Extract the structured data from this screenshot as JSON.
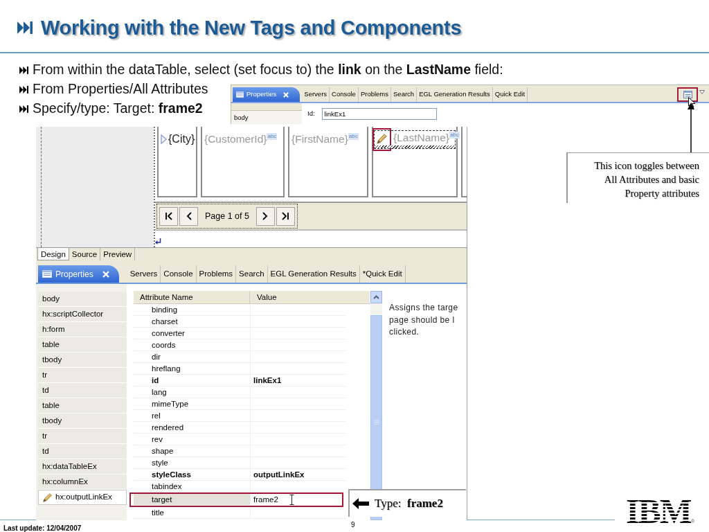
{
  "title": "Working with the New Tags and Components",
  "bullets": [
    "From within the dataTable, select (set focus to) the **link** on the **LastName** field:",
    "From Properties/All Attributes",
    "Specify/type: Target: **frame2**"
  ],
  "top_view": {
    "tabs": [
      {
        "label": "Properties",
        "selected": true
      },
      {
        "label": "Servers",
        "selected": false
      },
      {
        "label": "Console",
        "selected": false
      },
      {
        "label": "Problems",
        "selected": false
      },
      {
        "label": "Search",
        "selected": false
      },
      {
        "label": "EGL Generation Results",
        "selected": false
      },
      {
        "label": "Quick Edit",
        "selected": false
      }
    ],
    "tree_items": [
      {
        "label": "body"
      }
    ],
    "id_field": {
      "label": "Id:",
      "value": "linkEx1"
    }
  },
  "toggle_callout": {
    "lines": [
      "This icon toggles between",
      "All Attributes and basic",
      "Property attributes"
    ]
  },
  "design_view": {
    "columns": [
      {
        "kind": "text",
        "label": "{City}",
        "selected": false
      },
      {
        "kind": "output",
        "label": "{CustomerId}",
        "badge": "abc",
        "selected": false
      },
      {
        "kind": "output",
        "label": "{FirstName}",
        "badge": "abc",
        "selected": false
      },
      {
        "kind": "link",
        "label": "{LastName}",
        "badge": "abc",
        "selected": true
      }
    ],
    "pager": {
      "label": "Page 1 of 5"
    },
    "tabs": [
      {
        "label": "Design",
        "selected": true
      },
      {
        "label": "Source",
        "selected": false
      },
      {
        "label": "Preview",
        "selected": false
      }
    ]
  },
  "properties_view": {
    "tabs": [
      {
        "label": "Properties",
        "selected": true
      },
      {
        "label": "Servers",
        "selected": false
      },
      {
        "label": "Console",
        "selected": false
      },
      {
        "label": "Problems",
        "selected": false
      },
      {
        "label": "Search",
        "selected": false
      },
      {
        "label": "EGL Generation Results",
        "selected": false
      },
      {
        "label": "*Quick Edit",
        "selected": false
      }
    ],
    "tree_items": [
      {
        "label": "body",
        "selected": false
      },
      {
        "label": "hx:scriptCollector",
        "selected": false
      },
      {
        "label": "h:form",
        "selected": false
      },
      {
        "label": "table",
        "selected": false
      },
      {
        "label": "tbody",
        "selected": false
      },
      {
        "label": "tr",
        "selected": false
      },
      {
        "label": "td",
        "selected": false
      },
      {
        "label": "table",
        "selected": false
      },
      {
        "label": "tbody",
        "selected": false
      },
      {
        "label": "tr",
        "selected": false
      },
      {
        "label": "td",
        "selected": false
      },
      {
        "label": "hx:dataTableEx",
        "selected": false
      },
      {
        "label": "hx:columnEx",
        "selected": false
      },
      {
        "label": "hx:outputLinkEx",
        "selected": true
      }
    ],
    "table": {
      "columns": [
        "Attribute Name",
        "Value"
      ],
      "rows": [
        {
          "name": "binding",
          "set": false,
          "selected": false
        },
        {
          "name": "charset",
          "set": false,
          "selected": false
        },
        {
          "name": "converter",
          "set": false,
          "selected": false
        },
        {
          "name": "coords",
          "set": false,
          "selected": false
        },
        {
          "name": "dir",
          "set": false,
          "selected": false
        },
        {
          "name": "hreflang",
          "set": false,
          "selected": false
        },
        {
          "name": "id",
          "value": "linkEx1",
          "set": true,
          "selected": false
        },
        {
          "name": "lang",
          "set": false,
          "selected": false
        },
        {
          "name": "mimeType",
          "set": false,
          "selected": false
        },
        {
          "name": "rel",
          "set": false,
          "selected": false
        },
        {
          "name": "rendered",
          "set": false,
          "selected": false
        },
        {
          "name": "rev",
          "set": false,
          "selected": false
        },
        {
          "name": "shape",
          "set": false,
          "selected": false
        },
        {
          "name": "style",
          "set": false,
          "selected": false
        },
        {
          "name": "styleClass",
          "value": "outputLinkEx",
          "set": true,
          "selected": false
        },
        {
          "name": "tabindex",
          "set": false,
          "selected": false
        },
        {
          "name": "target",
          "value": "frame2",
          "set": false,
          "selected": true
        },
        {
          "name": "title",
          "set": false,
          "selected": false
        }
      ]
    },
    "description": [
      "Assigns the targe",
      "page should be l",
      "clicked."
    ]
  },
  "type_callout": {
    "text": "Type:  **frame2**"
  },
  "footer": {
    "last_update": "Last update: 12/04/2007",
    "page": "9"
  },
  "logo": {
    "text": "IBM",
    "mark": "®"
  }
}
